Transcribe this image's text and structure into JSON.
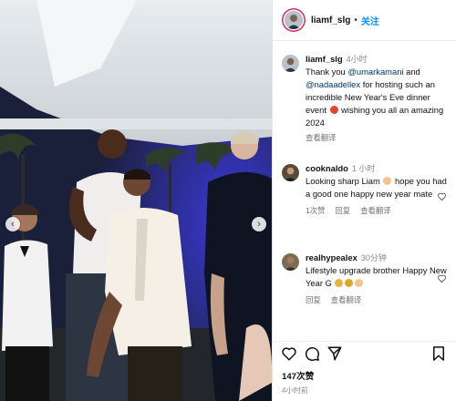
{
  "post": {
    "username": "liamf_slg",
    "follow_label": "关注",
    "header_separator": "•"
  },
  "caption": {
    "username": "liamf_slg",
    "time": "4小时",
    "text_before": "Thank you ",
    "mention_1": "@umarkamani",
    "text_and": " and",
    "mention_2": "@nadaadellex",
    "text_after": " for hosting such an incredible New Year's Eve dinner event",
    "text_end": " wishing you all an amazing 2024",
    "translate_label": "查看翻译",
    "emoji": "fire-emoji"
  },
  "comments": [
    {
      "username": "cooknaldo",
      "time": "1 小时",
      "text_a": "Looking sharp Liam",
      "text_b": " hope you had a good one happy new year mate",
      "likes": "1次赞",
      "reply": "回复",
      "translate": "查看翻译",
      "emoji": "hand-emoji"
    },
    {
      "username": "realhypealex",
      "time": "30分钟",
      "text": "Lifestyle upgrade brother Happy New Year G",
      "reply": "回复",
      "translate": "查看翻译",
      "emojis": [
        "party-popper-emoji",
        "medal-emoji",
        "hand-emoji"
      ]
    }
  ],
  "footer": {
    "likes": "147次赞",
    "time": "4小时前"
  },
  "icons": [
    "heart-icon",
    "comment-icon",
    "share-icon",
    "bookmark-icon",
    "chevron-left-icon",
    "chevron-right-icon"
  ],
  "colors": {
    "follow_blue": "#0095f6",
    "mention_navy": "#00376b",
    "story_ring": "#d62976"
  }
}
